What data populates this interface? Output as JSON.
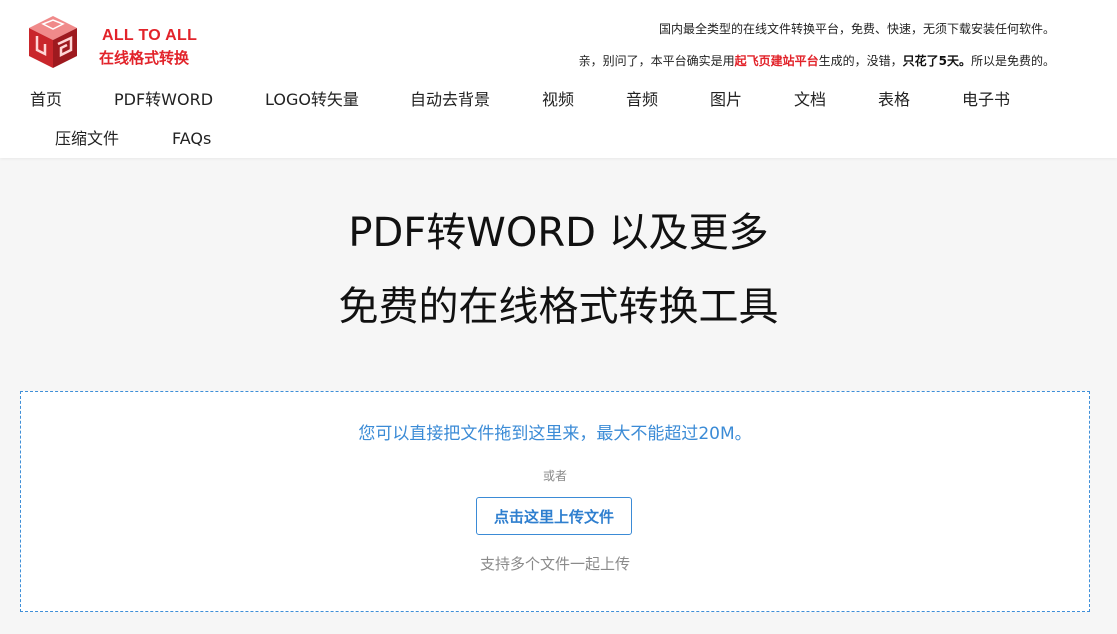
{
  "brand": {
    "name_en": "ALL TO ALL",
    "name_cn": "在线格式转换",
    "logo_icon": "cube-logo-icon",
    "color": "#e2232a"
  },
  "header": {
    "tagline": "国内最全类型的在线文件转换平台，免费、快速，无须下载安装任何软件。",
    "notice": {
      "prefix": "亲，别问了，本平台确实是用",
      "highlight": "起飞页建站平台",
      "middle": "生成的，没错，",
      "bold": "只花了5天。",
      "suffix": "所以是免费的。"
    }
  },
  "nav": {
    "items": [
      "首页",
      "PDF转WORD",
      "LOGO转矢量",
      "自动去背景",
      "视频",
      "音频",
      "图片",
      "文档",
      "表格",
      "电子书",
      "压缩文件",
      "FAQs"
    ]
  },
  "hero": {
    "line1": "PDF转WORD 以及更多",
    "line2": "免费的在线格式转换工具"
  },
  "upload": {
    "drop_hint": "您可以直接把文件拖到这里来，最大不能超过20M。",
    "or": "或者",
    "button_label": "点击这里上传文件",
    "multi_note": "支持多个文件一起上传",
    "accent_color": "#3b8bd6"
  }
}
